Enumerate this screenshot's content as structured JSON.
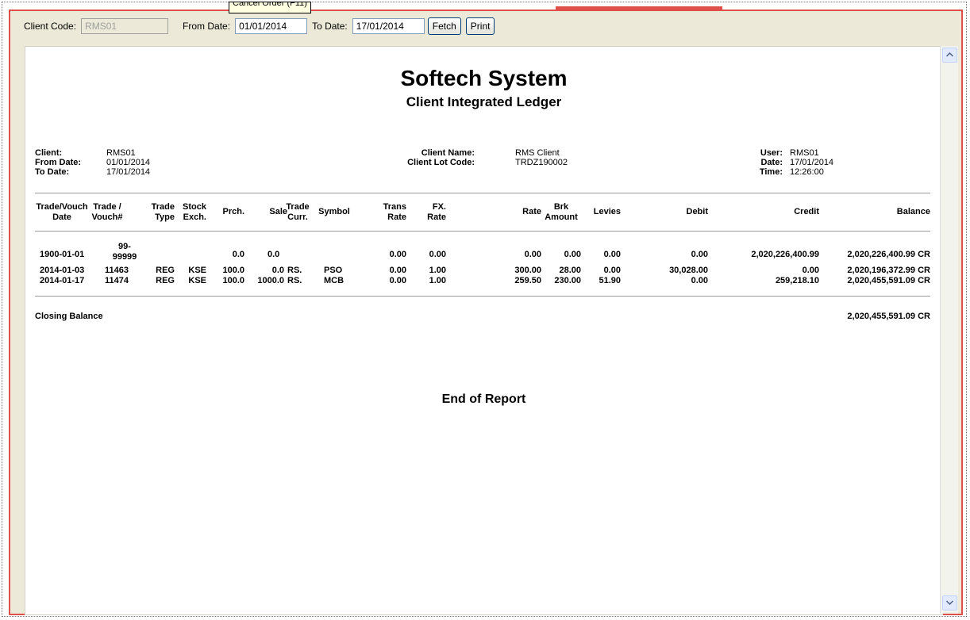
{
  "tooltip": "Cancel Order (F11)",
  "toolbar": {
    "client_code_label": "Client Code:",
    "client_code_value": "RMS01",
    "from_date_label": "From Date:",
    "from_date_value": "01/01/2014",
    "to_date_label": "To Date:",
    "to_date_value": "17/01/2014",
    "fetch_label": "Fetch",
    "print_label": "Print"
  },
  "report": {
    "title": "Softech System",
    "subtitle": "Client Integrated Ledger",
    "info_left": {
      "client_label": "Client:",
      "client": "RMS01",
      "from_label": "From Date:",
      "from": "01/01/2014",
      "to_label": "To Date:",
      "to": "17/01/2014"
    },
    "info_mid": {
      "name_label": "Client Name:",
      "name": "RMS Client",
      "lot_label": "Client Lot Code:",
      "lot": "TRDZ190002"
    },
    "info_right": {
      "user_label": "User:",
      "user": "RMS01",
      "date_label": "Date:",
      "date": "17/01/2014",
      "time_label": "Time:",
      "time": "12:26:00"
    },
    "headers": {
      "date_1": "Trade/Vouch",
      "date_2": "Date",
      "vouch_1": "Trade /",
      "vouch_2": "Vouch#",
      "type_1": "Trade",
      "type_2": "Type",
      "exch_1": "Stock",
      "exch_2": "Exch.",
      "prch": "Prch.",
      "sale": "Sale",
      "curr_1": "Trade",
      "curr_2": "Curr.",
      "symbol": "Symbol",
      "trate_1": "Trans",
      "trate_2": "Rate",
      "fx_1": "FX.",
      "fx_2": "Rate",
      "rate": "Rate",
      "brk_1": "Brk",
      "brk_2": "Amount",
      "levies": "Levies",
      "debit": "Debit",
      "credit": "Credit",
      "balance": "Balance"
    },
    "rows": [
      {
        "date": "1900-01-01",
        "vouch_1": "99-",
        "vouch_2": "99999",
        "type": "",
        "exch": "",
        "prch": "0.0",
        "sale": "0.0",
        "curr": "",
        "symbol": "",
        "trate": "0.00",
        "fx": "0.00",
        "rate": "0.00",
        "brk": "0.00",
        "levies": "0.00",
        "debit": "0.00",
        "credit": "2,020,226,400.99",
        "balance": "2,020,226,400.99 CR"
      },
      {
        "date": "2014-01-03",
        "vouch": "11463",
        "type": "REG",
        "exch": "KSE",
        "prch": "100.0",
        "sale": "0.0",
        "curr": "RS.",
        "symbol": "PSO",
        "trate": "0.00",
        "fx": "1.00",
        "rate": "300.00",
        "brk": "28.00",
        "levies": "0.00",
        "debit": "30,028.00",
        "credit": "0.00",
        "balance": "2,020,196,372.99 CR"
      },
      {
        "date": "2014-01-17",
        "vouch": "11474",
        "type": "REG",
        "exch": "KSE",
        "prch": "100.0",
        "sale": "1000.0",
        "curr": "RS.",
        "symbol": "MCB",
        "trate": "0.00",
        "fx": "1.00",
        "rate": "259.50",
        "brk": "230.00",
        "levies": "51.90",
        "debit": "0.00",
        "credit": "259,218.10",
        "balance": "2,020,455,591.09 CR"
      }
    ],
    "closing_label": "Closing Balance",
    "closing_value": "2,020,455,591.09 CR",
    "end_text": "End of Report"
  },
  "scroll": {
    "up_icon": "arrow-up",
    "down_icon": "arrow-down"
  }
}
